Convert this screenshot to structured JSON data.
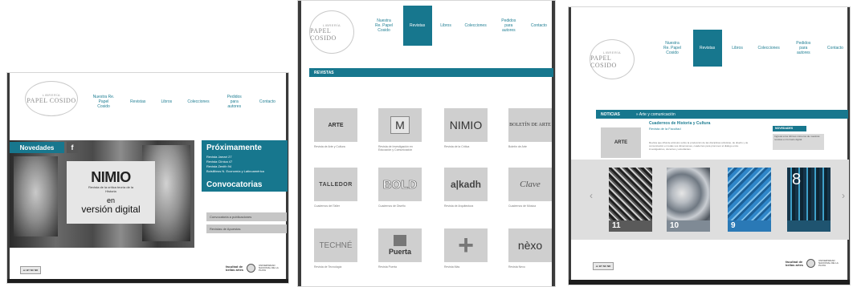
{
  "logo": {
    "small_text": "LIBRERÍA",
    "name": "PAPEL COSIDO"
  },
  "nav": [
    "Nuestra Re. Papel Cosido",
    "Revistas",
    "Libros",
    "Colecciones",
    "Pedidos para autores",
    "Contacto"
  ],
  "panel_home": {
    "novedades": "Novedades",
    "banner": {
      "title": "NIMIO",
      "subtitle": "Revista de la crítica teoría de la Historia",
      "en": "en",
      "digital": "versión digital"
    },
    "proximamente": {
      "title": "Próximamente",
      "items": [
        "Revista Jarrarí 27",
        "Revista Clínica 47",
        "Revista Zenith 94",
        "Bolsilibros N. Economía y Latinoamérica"
      ]
    },
    "convocatorias": "Convocatorias",
    "side_links": [
      "Convocatoria a publicaciones",
      "Revistas de Apuestas"
    ],
    "fb_badge": "f"
  },
  "panel_revistas": {
    "section_title": "REVISTAS",
    "tiles": [
      {
        "label": "ARTE",
        "caption": "Revista de Arte y Cultura"
      },
      {
        "label": "M",
        "caption": "Revista de Investigación en Educación y Comunicación"
      },
      {
        "label": "NIMIO",
        "caption": "Revista de la Crítica"
      },
      {
        "label": "BOLETÍN DE ARTE",
        "caption": "Boletín de Arte"
      },
      {
        "label": "TALLEDOR",
        "caption": "Cuadernos del Taller"
      },
      {
        "label": "BOLD",
        "caption": "Cuadernos de Diseño"
      },
      {
        "label": "a|kadh",
        "caption": "Revista de Arquitectura"
      },
      {
        "label": "Clave",
        "caption": "Cuadernos de Música"
      },
      {
        "label": "TECHNÉ",
        "caption": "Revista de Tecnología"
      },
      {
        "label": "Puerta",
        "caption": "Revista Puerta"
      },
      {
        "label": "+",
        "caption": "Revista Más"
      },
      {
        "label": "nèxo",
        "caption": "Revista Nexo"
      }
    ]
  },
  "panel_noticias": {
    "section_title": "NOTICIAS",
    "breadcrumb": "» Arte y comunicación",
    "article_title": "Cuadernos de Historia y Cultura",
    "article_subtitle": "Revista de la Facultad",
    "article_body": "Revista que difunde artículos sobre la producción de las disciplinas artísticas, de diseño y de comunicación en todas sus dimensiones, cuadernos para promover el diálogo entre investigadores, docentes y estudiantes.",
    "sidebar_title": "NOVEDADES",
    "sidebar_text": "Ingresá a los últimos números de nuestras revistas en formato digital.",
    "covers": [
      {
        "number": "11",
        "color": "#3b3b3b"
      },
      {
        "number": "10",
        "color": "#7f8a95"
      },
      {
        "number": "9",
        "color": "#2f86c9"
      },
      {
        "number": "8",
        "color": "#15354a"
      }
    ],
    "arrow_left": "‹",
    "arrow_right": "›"
  },
  "footer": {
    "cc_label": "cc BY NC ND",
    "faculty_line1": "facultad de",
    "faculty_line2": "bellas artes",
    "university": "UNIVERSIDAD NACIONAL DE LA PLATA"
  }
}
